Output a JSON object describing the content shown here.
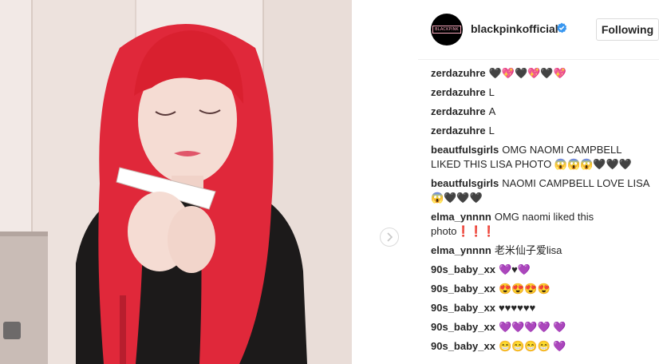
{
  "post": {
    "account": "blackpinkofficial",
    "avatar_text": "BLACKPINK",
    "follow_label": "Following"
  },
  "comments": [
    {
      "user": "zerdazuhre",
      "text": "🖤💖🖤💖🖤💖"
    },
    {
      "user": "zerdazuhre",
      "text": "L"
    },
    {
      "user": "zerdazuhre",
      "text": "A"
    },
    {
      "user": "zerdazuhre",
      "text": "L"
    },
    {
      "user": "beautfulsgirls",
      "text": "OMG NAOMI CAMPBELL LIKED THIS LISA PHOTO 😱😱😱🖤🖤🖤"
    },
    {
      "user": "beautfulsgirls",
      "text": "NAOMI CAMPBELL LOVE LISA 😱🖤🖤🖤"
    },
    {
      "user": "elma_ynnnn",
      "text": "OMG naomi liked this photo❗❗❗"
    },
    {
      "user": "elma_ynnnn",
      "text": "老米仙子爱lisa"
    },
    {
      "user": "90s_baby_xx",
      "text": "💜♥💜"
    },
    {
      "user": "90s_baby_xx",
      "text": "😍😍😍😍"
    },
    {
      "user": "90s_baby_xx",
      "text": "♥♥♥♥♥♥"
    },
    {
      "user": "90s_baby_xx",
      "text": "💜💜💜💜 💜"
    },
    {
      "user": "90s_baby_xx",
      "text": "😁😁😁😁 💜"
    }
  ],
  "colors": {
    "hair": "#e0283a",
    "verified": "#3897f0",
    "avatar_logo": "#f7a7bb"
  },
  "icons": {
    "verified": "verified-badge-icon",
    "next": "chevron-right-icon"
  }
}
